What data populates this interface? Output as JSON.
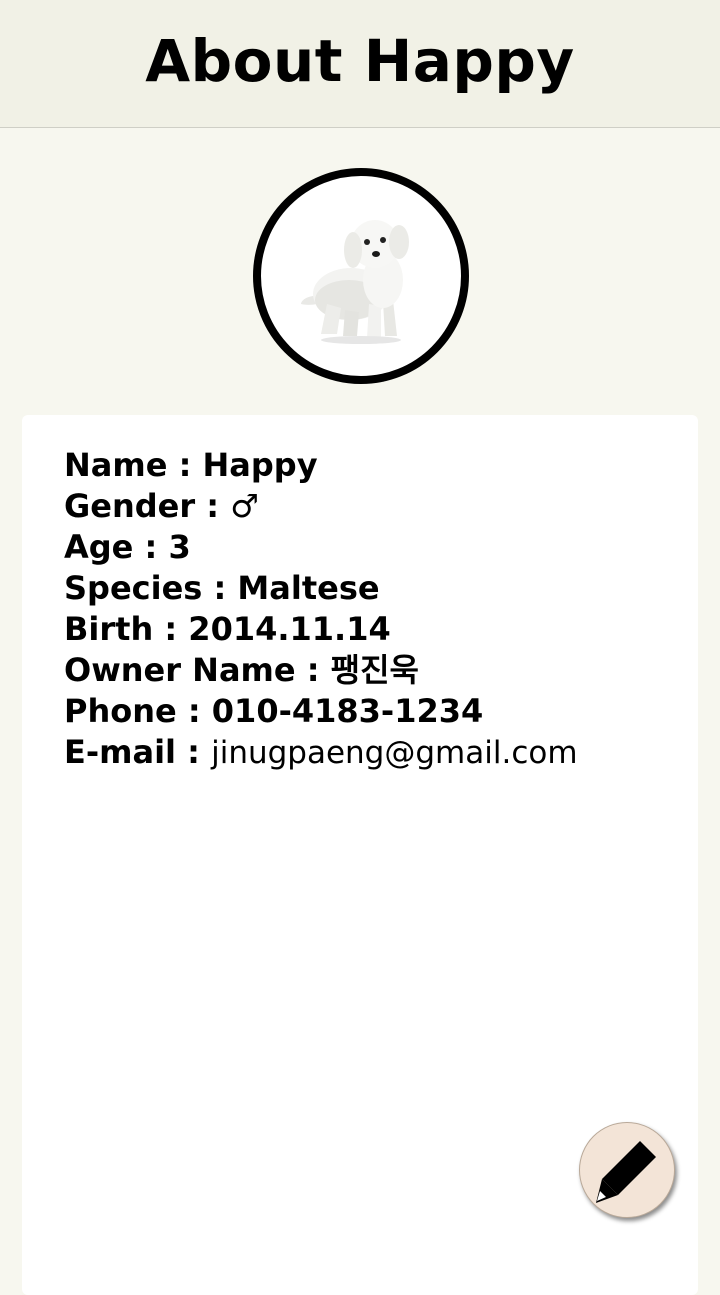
{
  "header": {
    "title": "About Happy"
  },
  "profile": {
    "avatar_icon": "maltese-dog-photo"
  },
  "info": {
    "rows": [
      {
        "label": "Name : ",
        "value": "Happy"
      },
      {
        "label": "Gender : ",
        "value": "♂"
      },
      {
        "label": "Age : ",
        "value": "3"
      },
      {
        "label": "Species : ",
        "value": "Maltese"
      },
      {
        "label": "Birth : ",
        "value": "2014.11.14"
      },
      {
        "label": "Owner Name : ",
        "value": "팽진욱"
      },
      {
        "label": "Phone : ",
        "value": "010-4183-1234"
      },
      {
        "label": "E-mail : ",
        "value": "jinugpaeng@gmail.com"
      }
    ]
  },
  "fab": {
    "icon": "pencil-icon",
    "background": "#f3e4d7"
  },
  "colors": {
    "page_background": "#f7f7ef",
    "app_bar_background": "#f1f1e6",
    "card_background": "#ffffff",
    "text": "#000000"
  }
}
